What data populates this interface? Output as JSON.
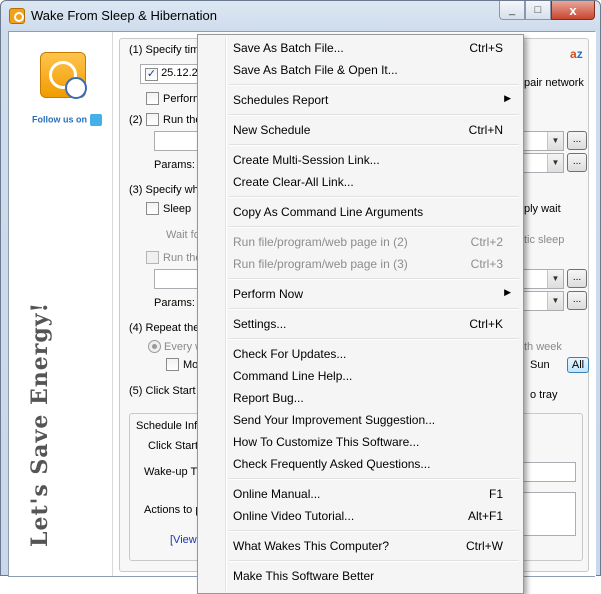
{
  "window": {
    "title": "Wake From Sleep & Hibernation",
    "close_glyph": "x",
    "min_glyph": "_",
    "max_glyph": "□"
  },
  "left": {
    "follow_text": "Follow us on",
    "slogan": "Let's Save Energy!"
  },
  "main": {
    "step1": "(1) Specify time",
    "date_value": "25.12.20",
    "perform": "Perform",
    "pair_network": "pair network",
    "step2": "(2)",
    "run_the": "Run the",
    "params": "Params:",
    "step3": "(3) Specify what",
    "sleep": "Sleep",
    "ply_wait": "ply wait",
    "wait_for": "Wait for",
    "tic_sleep": "tic sleep",
    "run_the2": "Run the",
    "params2": "Params:",
    "step4": "(4) Repeat thes",
    "every_we": "Every we",
    "th_week": "th week",
    "mon": "Mon",
    "sun": "Sun",
    "all_btn": "All",
    "step5": "(5) Click Start to",
    "to_tray": "o tray",
    "sched_info": "Schedule Info",
    "click_start": "Click Start b",
    "wakeup_time": "Wake-up Tim",
    "actions_to": "Actions to p",
    "view_link": "[View A",
    "browse": "...",
    "az_a": "a",
    "az_z": "z"
  },
  "menu": {
    "items": [
      {
        "label": "Save As Batch File...",
        "shortcut": "Ctrl+S"
      },
      {
        "label": "Save As Batch File & Open It...",
        "shortcut": ""
      },
      {
        "label": "Schedules Report",
        "shortcut": ""
      },
      {
        "label": "New Schedule",
        "shortcut": "Ctrl+N"
      },
      {
        "label": "Create Multi-Session Link...",
        "shortcut": ""
      },
      {
        "label": "Create Clear-All Link...",
        "shortcut": ""
      },
      {
        "label": "Copy As Command Line Arguments",
        "shortcut": ""
      },
      {
        "label": "Run file/program/web page in (2)",
        "shortcut": "Ctrl+2"
      },
      {
        "label": "Run file/program/web page in (3)",
        "shortcut": "Ctrl+3"
      },
      {
        "label": "Perform Now",
        "shortcut": ""
      },
      {
        "label": "Settings...",
        "shortcut": "Ctrl+K"
      },
      {
        "label": "Check For Updates...",
        "shortcut": ""
      },
      {
        "label": "Command Line Help...",
        "shortcut": ""
      },
      {
        "label": "Report Bug...",
        "shortcut": ""
      },
      {
        "label": "Send Your Improvement Suggestion...",
        "shortcut": ""
      },
      {
        "label": "How To Customize This Software...",
        "shortcut": ""
      },
      {
        "label": "Check Frequently Asked Questions...",
        "shortcut": ""
      },
      {
        "label": "Online Manual...",
        "shortcut": "F1"
      },
      {
        "label": "Online Video Tutorial...",
        "shortcut": "Alt+F1"
      },
      {
        "label": "What Wakes This Computer?",
        "shortcut": "Ctrl+W"
      },
      {
        "label": "Make This Software Better",
        "shortcut": ""
      }
    ],
    "submenu_arrow": "▶"
  }
}
